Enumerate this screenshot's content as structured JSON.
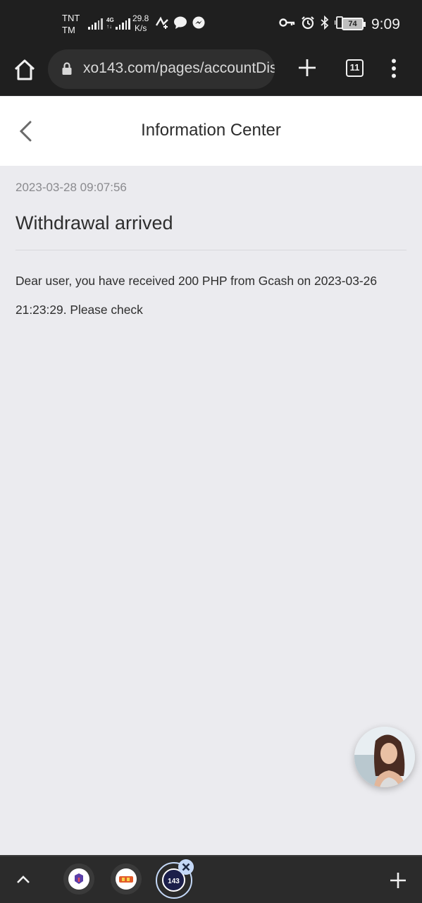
{
  "status_bar": {
    "carrier_1": "TNT",
    "carrier_2": "TM",
    "net_type_top": "4G",
    "net_type_bottom": "↑↓",
    "speed_value": "29.8",
    "speed_unit": "K/s",
    "battery": "74",
    "time": "9:09",
    "icons": [
      "signal-icon",
      "signal-icon",
      "data-saver-icon",
      "chat-bubble-icon",
      "messenger-icon",
      "vpn-key-icon",
      "alarm-icon",
      "bluetooth-icon",
      "vibrate-icon",
      "battery-icon"
    ]
  },
  "browser": {
    "url": "xo143.com/pages/accountDis",
    "tab_count": "11",
    "icons": [
      "home-icon",
      "lock-icon",
      "plus-icon",
      "more-vert-icon"
    ]
  },
  "page": {
    "title": "Information Center",
    "back_icon": "chevron-left-icon"
  },
  "message": {
    "time": "2023-03-28 09:07:56",
    "title": "Withdrawal arrived",
    "body": "Dear user, you have received 200 PHP from Gcash on 2023-03-26 21:23:29. Please check"
  },
  "bottom_bar": {
    "icons": [
      "chevron-up-icon",
      "tab-favicon-icon",
      "tab-favicon-icon",
      "tab-favicon-icon",
      "close-icon",
      "plus-icon"
    ],
    "active_tab_label": "143"
  },
  "colors": {
    "system_bar": "#1f1f1f",
    "page_background": "#ebebef",
    "header_background": "#ffffff",
    "text_primary": "#2e2e2e",
    "text_secondary": "#8a8a8e",
    "active_tab_ring": "#c4d8f7"
  }
}
